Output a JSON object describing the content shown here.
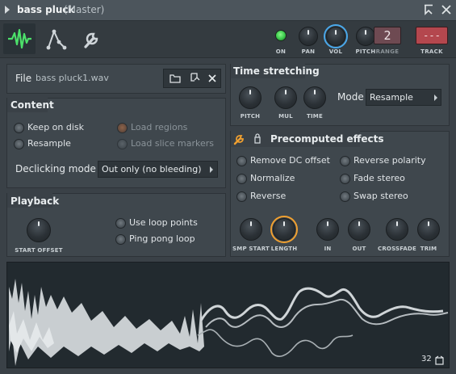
{
  "window": {
    "title": "bass pluck",
    "title_suffix": "(Master)"
  },
  "toolbar": {
    "on_label": "ON",
    "pan_label": "PAN",
    "vol_label": "VOL",
    "pitch_label": "PITCH",
    "range_label": "RANGE",
    "range_value": "2",
    "track_label": "TRACK",
    "track_value": "---"
  },
  "file": {
    "label": "File",
    "name": "bass pluck1.wav"
  },
  "content": {
    "title": "Content",
    "keep_on_disk": "Keep on disk",
    "resample": "Resample",
    "load_regions": "Load regions",
    "load_slice_markers": "Load slice markers",
    "declicking_label": "Declicking mode",
    "declicking_value": "Out only (no bleeding)"
  },
  "playback": {
    "title": "Playback",
    "start_offset": "START OFFSET",
    "use_loop_points": "Use loop points",
    "ping_pong_loop": "Ping pong loop"
  },
  "time_stretching": {
    "title": "Time stretching",
    "pitch": "PITCH",
    "mul": "MUL",
    "time": "TIME",
    "mode_label": "Mode",
    "mode_value": "Resample"
  },
  "precomputed": {
    "title": "Precomputed effects",
    "remove_dc": "Remove DC offset",
    "normalize": "Normalize",
    "reverse": "Reverse",
    "reverse_polarity": "Reverse polarity",
    "fade_stereo": "Fade stereo",
    "swap_stereo": "Swap stereo",
    "knobs": [
      "SMP START",
      "LENGTH",
      "IN",
      "OUT",
      "CROSSFADE",
      "TRIM"
    ]
  },
  "waveform": {
    "zoom_value": "32"
  },
  "colors": {
    "accent_green": "#4cd964",
    "accent_blue": "#3aa0e0",
    "accent_orange": "#f0a030",
    "track_red": "#b44a50"
  }
}
